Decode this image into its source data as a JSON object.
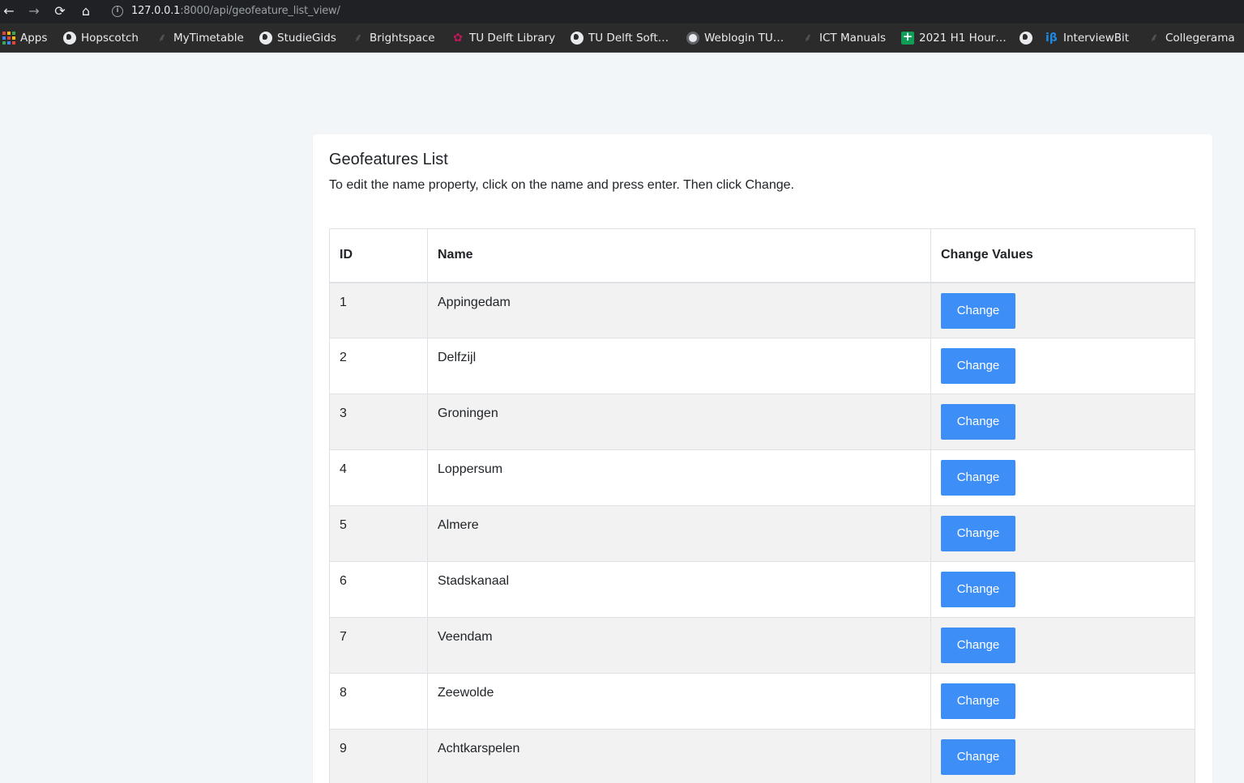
{
  "browser": {
    "url_host": "127.0.0.1",
    "url_rest": ":8000/api/geofeature_list_view/",
    "bookmarks": [
      {
        "label": "Apps",
        "icon": "apps-grid-icon"
      },
      {
        "label": "Hopscotch",
        "icon": "globe-icon"
      },
      {
        "label": "MyTimetable",
        "icon": "swoosh-icon"
      },
      {
        "label": "StudieGids",
        "icon": "globe-icon"
      },
      {
        "label": "Brightspace",
        "icon": "swoosh-icon"
      },
      {
        "label": "TU Delft Library",
        "icon": "library-icon"
      },
      {
        "label": "TU Delft Soft…",
        "icon": "globe-icon"
      },
      {
        "label": "Weblogin TU…",
        "icon": "weblogin-icon"
      },
      {
        "label": "ICT Manuals",
        "icon": "swoosh-icon"
      },
      {
        "label": "2021 H1 Hour…",
        "icon": "sheets-icon"
      },
      {
        "label": "",
        "icon": "globe-icon"
      },
      {
        "label": "InterviewBit",
        "icon": "interviewbit-icon"
      },
      {
        "label": "Collegerama",
        "icon": "swoosh-icon"
      }
    ]
  },
  "page": {
    "title": "Geofeatures List",
    "subtitle": "To edit the name property, click on the name and press enter. Then click Change.",
    "table": {
      "headers": [
        "ID",
        "Name",
        "Change Values"
      ],
      "button_label": "Change",
      "rows": [
        {
          "id": "1",
          "name": "Appingedam"
        },
        {
          "id": "2",
          "name": "Delfzijl"
        },
        {
          "id": "3",
          "name": "Groningen"
        },
        {
          "id": "4",
          "name": "Loppersum"
        },
        {
          "id": "5",
          "name": "Almere"
        },
        {
          "id": "6",
          "name": "Stadskanaal"
        },
        {
          "id": "7",
          "name": "Veendam"
        },
        {
          "id": "8",
          "name": "Zeewolde"
        },
        {
          "id": "9",
          "name": "Achtkarspelen"
        }
      ]
    }
  },
  "colors": {
    "button": "#3e8ef7",
    "page_bg": "#f3f6f9",
    "stripe": "#f2f2f2"
  }
}
